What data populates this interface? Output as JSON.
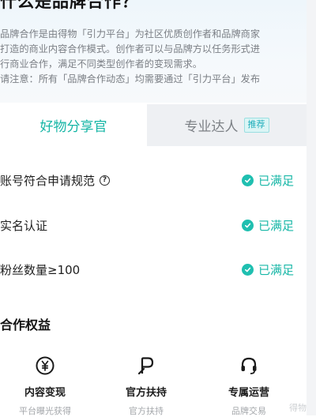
{
  "hero": {
    "title": "什么是品牌合作？",
    "desc_lines": [
      "品牌合作是由得物「引力平台」为社区优质创作者和品牌商家",
      "打造的商业内容合作模式。创作者可以与品牌方以任务形式进",
      "行商业合作，满足不同类型创作者的变现需求。",
      "请注意：所有「品牌合作动态」均需要通过「引力平台」发布"
    ]
  },
  "tabs": {
    "left": "好物分享官",
    "right": "专业达人",
    "right_badge": "推荐"
  },
  "requirements": [
    {
      "label": "账号符合申请规范",
      "status": "已满足"
    },
    {
      "label": "实名认证",
      "status": "已满足"
    },
    {
      "label": "粉丝数量≥100",
      "status": "已满足"
    }
  ],
  "benefits_section": {
    "title": "合作权益",
    "items": [
      {
        "icon": "yen-circle-icon",
        "title": "内容变现",
        "subtitle": "平台曝光获得"
      },
      {
        "icon": "p-flag-icon",
        "title": "官方扶持",
        "subtitle": "官方扶持"
      },
      {
        "icon": "headset-icon",
        "title": "专属运营",
        "subtitle": "品牌交易"
      }
    ]
  },
  "watermark": "得物",
  "colors": {
    "accent": "#1fbfb0",
    "status_text": "#18b7a7",
    "muted_text": "#7b7f85",
    "inactive_tab_bg": "#eef0f3"
  }
}
